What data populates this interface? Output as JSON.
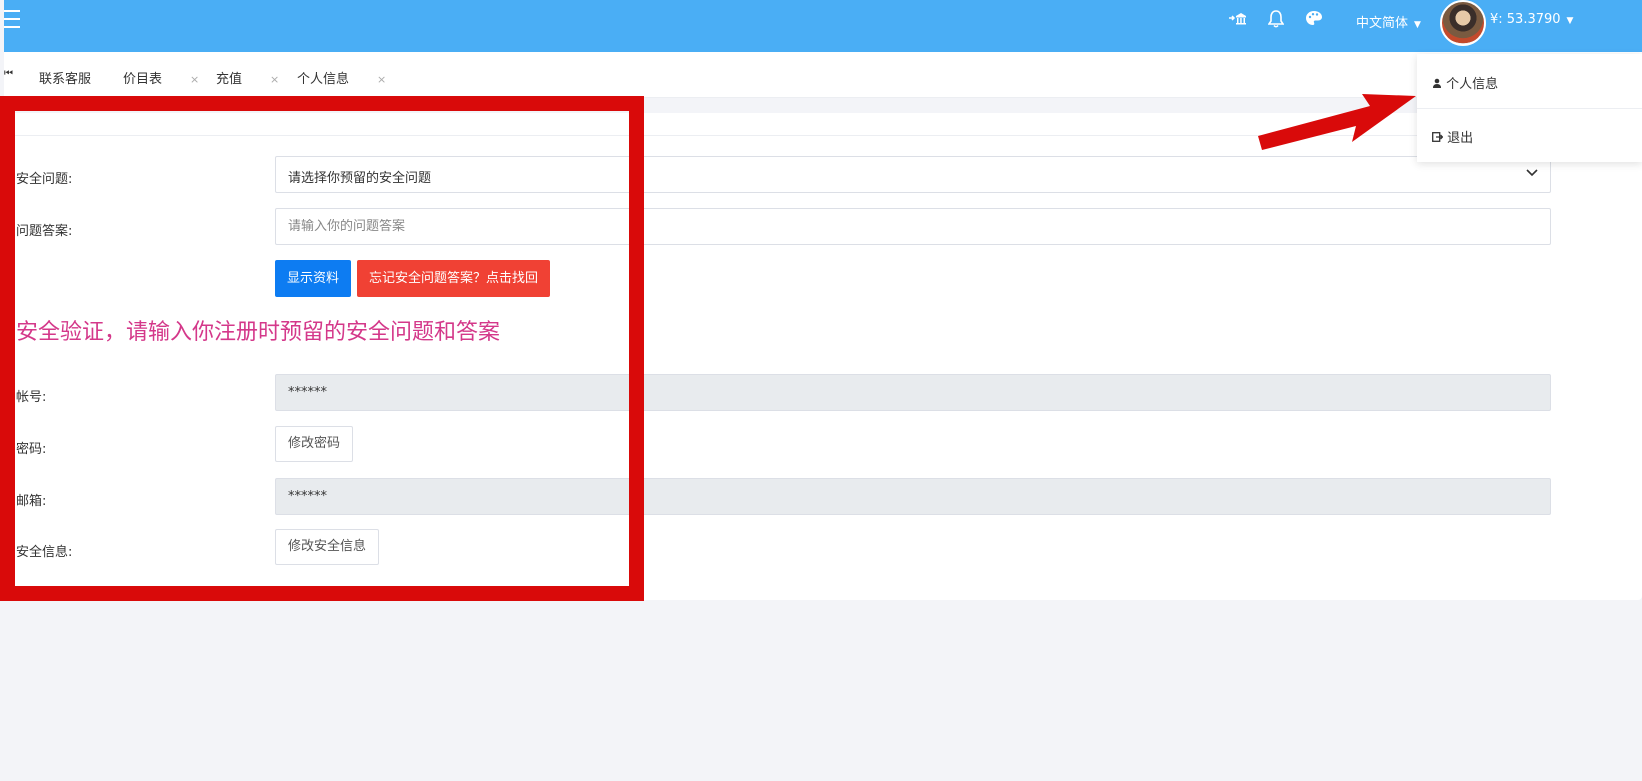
{
  "header": {
    "lang_label": "中文简体",
    "balance_label": "¥:  53.3790",
    "icons": [
      "bank-icon",
      "bell-icon",
      "palette-icon"
    ]
  },
  "tabs": [
    {
      "label": "联系客服",
      "closable": false
    },
    {
      "label": "价目表",
      "closable": true
    },
    {
      "label": "充值",
      "closable": true
    },
    {
      "label": "个人信息",
      "closable": true
    }
  ],
  "tab_close_glyph": "×",
  "form": {
    "security_question_label": "安全问题:",
    "security_question_value": "请选择你预留的安全问题",
    "answer_label": "问题答案:",
    "answer_placeholder": "请输入你的问题答案",
    "show_button": "显示资料",
    "forgot_button": "忘记安全问题答案？点击找回",
    "notice": "安全验证，请输入你注册时预留的安全问题和答案",
    "account_label": "帐号:",
    "account_value": "******",
    "password_label": "密码:",
    "change_password_button": "修改密码",
    "email_label": "邮箱:",
    "email_value": "******",
    "security_info_label": "安全信息:",
    "change_security_button": "修改安全信息"
  },
  "dropdown": {
    "profile_label": "个人信息",
    "logout_label": "退出"
  },
  "colors": {
    "header": "#4aaef5",
    "primary": "#0d7cf2",
    "danger": "#f04134",
    "notice": "#d4388a",
    "annotation": "#d90a0a"
  }
}
